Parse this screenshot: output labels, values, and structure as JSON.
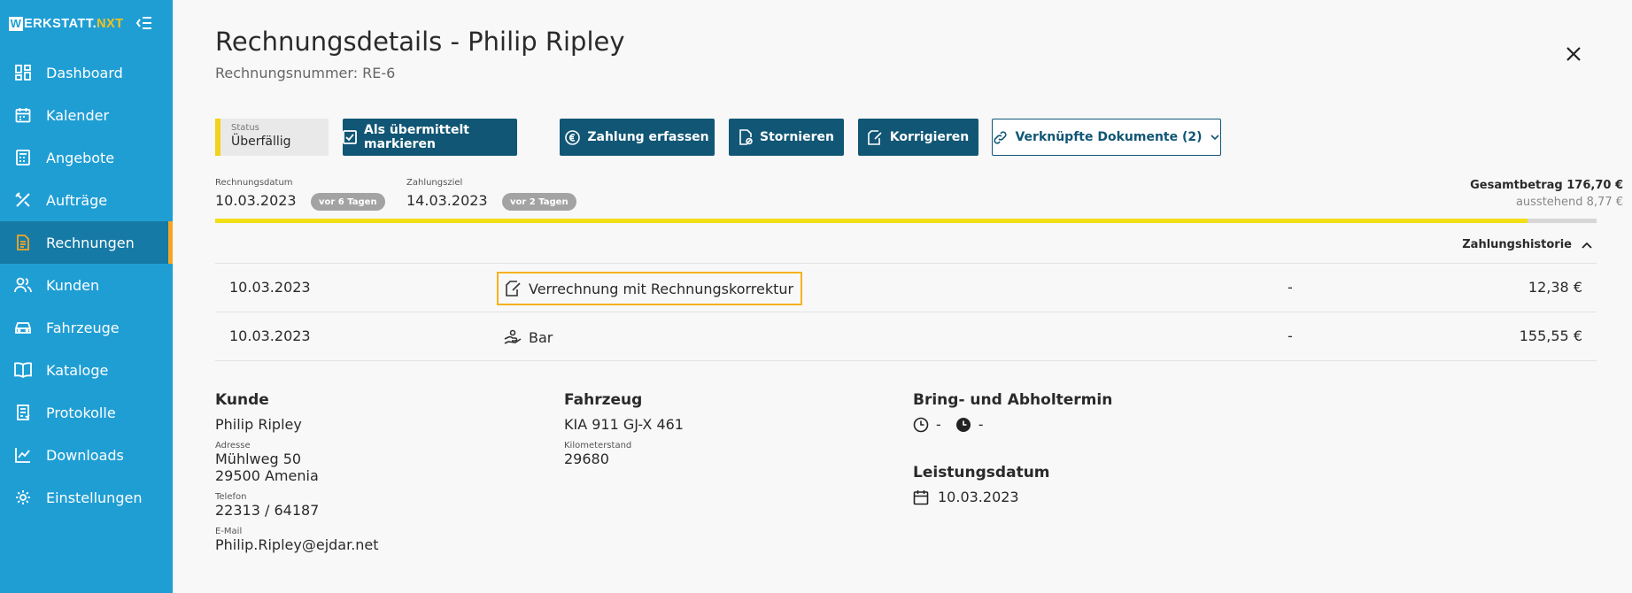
{
  "app": {
    "logo_letter": "W",
    "logo_main": "ERKSTATT.",
    "logo_accent": "NXT"
  },
  "sidebar": {
    "items": [
      {
        "label": "Dashboard",
        "icon": "dashboard-icon"
      },
      {
        "label": "Kalender",
        "icon": "calendar-icon"
      },
      {
        "label": "Angebote",
        "icon": "calculator-icon"
      },
      {
        "label": "Aufträge",
        "icon": "tools-icon"
      },
      {
        "label": "Rechnungen",
        "icon": "invoice-icon",
        "active": true
      },
      {
        "label": "Kunden",
        "icon": "users-icon"
      },
      {
        "label": "Fahrzeuge",
        "icon": "car-icon"
      },
      {
        "label": "Kataloge",
        "icon": "book-icon"
      },
      {
        "label": "Protokolle",
        "icon": "protocol-icon"
      },
      {
        "label": "Downloads",
        "icon": "chart-line-icon"
      },
      {
        "label": "Einstellungen",
        "icon": "gear-icon"
      }
    ]
  },
  "header": {
    "title": "Rechnungsdetails - Philip Ripley",
    "subtitle": "Rechnungsnummer: RE-6"
  },
  "status": {
    "label": "Status",
    "value": "Überfällig",
    "color": "#f2d21a"
  },
  "toolbar": {
    "mark_sent": "Als übermittelt markieren",
    "record_payment": "Zahlung erfassen",
    "cancel": "Stornieren",
    "correct": "Korrigieren",
    "linked_docs": "Verknüpfte Dokumente (2)"
  },
  "dates": {
    "invoice_date_label": "Rechnungsdatum",
    "invoice_date": "10.03.2023",
    "invoice_date_ago": "vor 6 Tagen",
    "due_label": "Zahlungsziel",
    "due_date": "14.03.2023",
    "due_ago": "vor 2 Tagen"
  },
  "totals": {
    "total": "Gesamtbetrag 176,70 €",
    "outstanding": "ausstehend 8,77 €",
    "paid_fraction": 0.95
  },
  "history": {
    "title": "Zahlungshistorie",
    "rows": [
      {
        "date": "10.03.2023",
        "method": "Verrechnung mit Rechnungskorrektur",
        "icon": "document-edit-icon",
        "ref": "-",
        "amount": "12,38 €"
      },
      {
        "date": "10.03.2023",
        "method": "Bar",
        "icon": "cash-hand-icon",
        "ref": "-",
        "amount": "155,55 €"
      }
    ]
  },
  "customer": {
    "heading": "Kunde",
    "name": "Philip Ripley",
    "address_label": "Adresse",
    "street": "Mühlweg 50",
    "city": "29500 Amenia",
    "phone_label": "Telefon",
    "phone": "22313 / 64187",
    "email_label": "E-Mail",
    "email": "Philip.Ripley@ejdar.net"
  },
  "vehicle": {
    "heading": "Fahrzeug",
    "name": "KIA 911 GJ-X 461",
    "km_label": "Kilometerstand",
    "km": "29680"
  },
  "appointment": {
    "heading": "Bring- und Abholtermin",
    "bring": "-",
    "pickup": "-"
  },
  "service": {
    "heading": "Leistungsdatum",
    "date": "10.03.2023"
  }
}
